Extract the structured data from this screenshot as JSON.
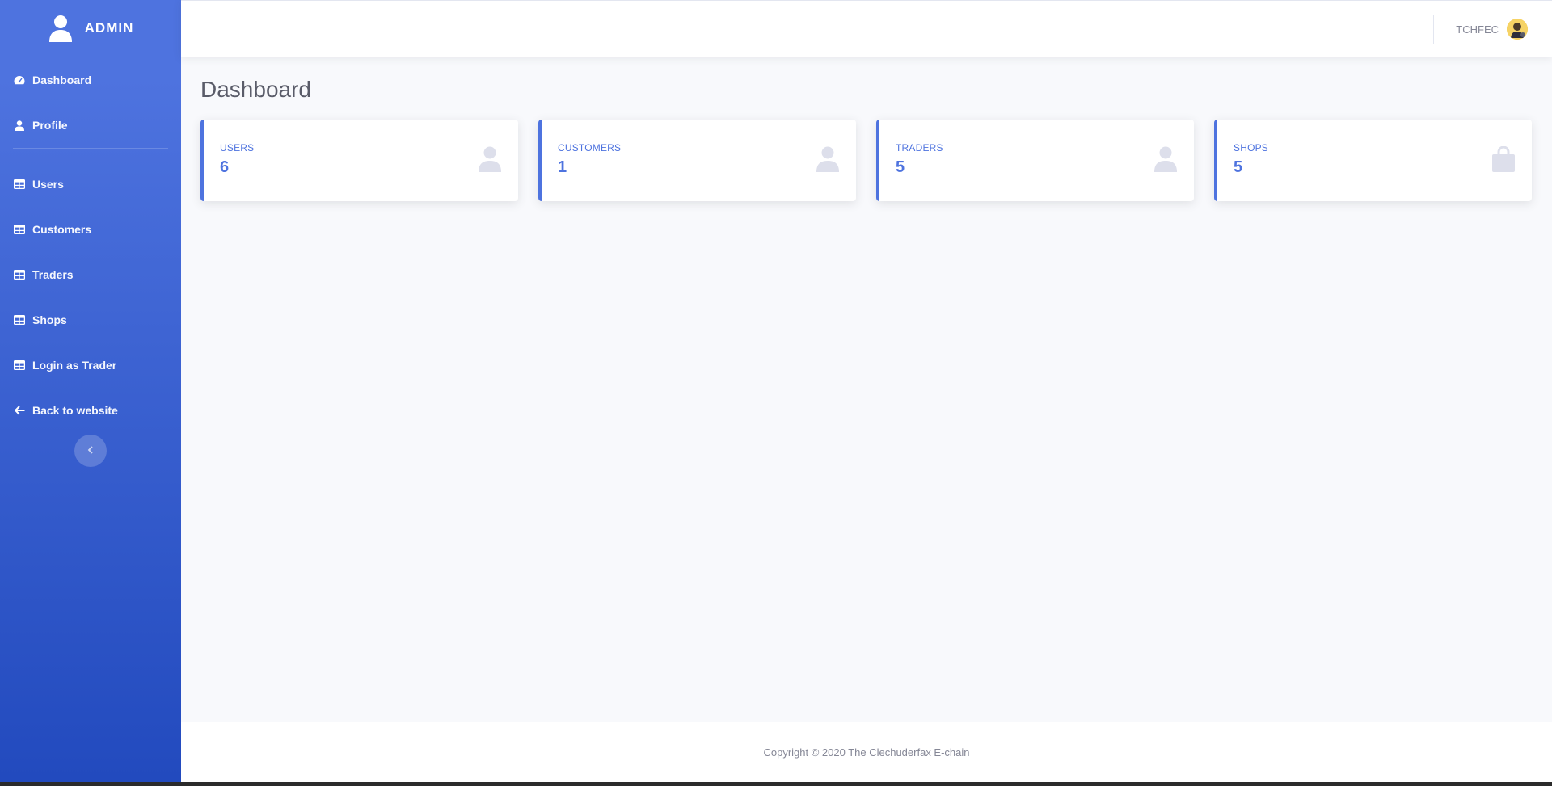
{
  "sidebar": {
    "brand": "ADMIN",
    "items": [
      {
        "label": "Dashboard",
        "icon": "tachometer-icon"
      },
      {
        "label": "Profile",
        "icon": "user-icon"
      },
      {
        "label": "Users",
        "icon": "table-icon"
      },
      {
        "label": "Customers",
        "icon": "table-icon"
      },
      {
        "label": "Traders",
        "icon": "table-icon"
      },
      {
        "label": "Shops",
        "icon": "table-icon"
      },
      {
        "label": "Login as Trader",
        "icon": "table-icon"
      },
      {
        "label": "Back to website",
        "icon": "arrow-left-icon"
      }
    ],
    "toggle_icon": "chevron-left-icon"
  },
  "topbar": {
    "user_name": "TCHFEC"
  },
  "main": {
    "title": "Dashboard",
    "cards": [
      {
        "label": "USERS",
        "value": "6",
        "icon": "user-icon"
      },
      {
        "label": "CUSTOMERS",
        "value": "1",
        "icon": "user-icon"
      },
      {
        "label": "TRADERS",
        "value": "5",
        "icon": "user-icon"
      },
      {
        "label": "SHOPS",
        "value": "5",
        "icon": "shopping-bag-icon"
      }
    ]
  },
  "footer": {
    "text": "Copyright © 2020 The Clechuderfax E-chain"
  },
  "colors": {
    "primary": "#4e73df",
    "sidebar_gradient_end": "#224abe",
    "background": "#f8f9fc",
    "text_muted": "#858796",
    "heading": "#5a5c69"
  }
}
